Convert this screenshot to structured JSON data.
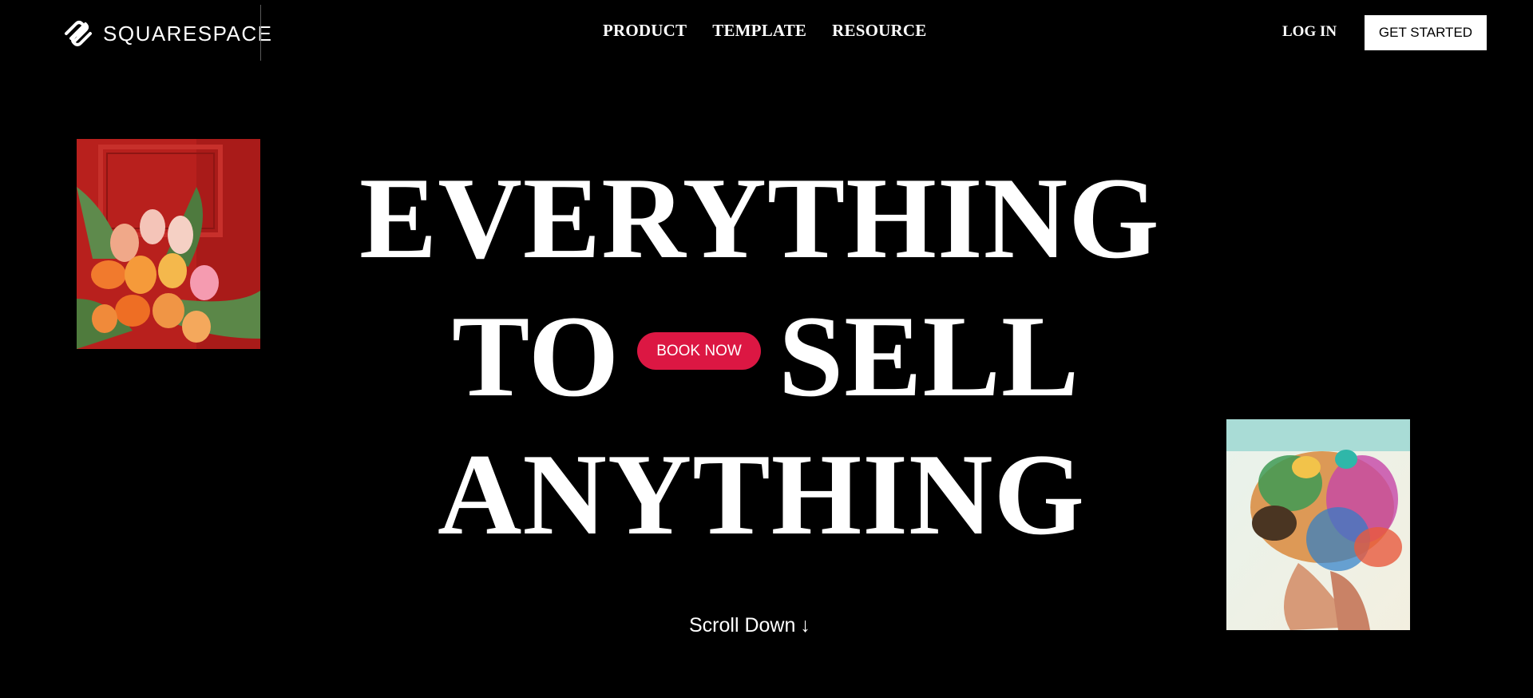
{
  "header": {
    "logo_text": "SQUARESPACE",
    "nav": [
      {
        "label": "PRODUCT"
      },
      {
        "label": "TEMPLATE"
      },
      {
        "label": "RESOURCE"
      }
    ],
    "login_label": "LOG IN",
    "cta_label": "GET STARTED"
  },
  "hero": {
    "line1": "EVERYTHING",
    "line2_left": "TO",
    "line2_right": "SELL",
    "line3": "ANYTHING",
    "book_now_label": "BOOK NOW",
    "scroll_label": "Scroll Down",
    "scroll_arrow": "↓"
  },
  "images": {
    "left": "orange and pink tulips against red door",
    "right": "colorful surreal portrait artwork"
  },
  "colors": {
    "background": "#000000",
    "text": "#ffffff",
    "accent": "#dc1743",
    "cta_bg": "#ffffff"
  }
}
